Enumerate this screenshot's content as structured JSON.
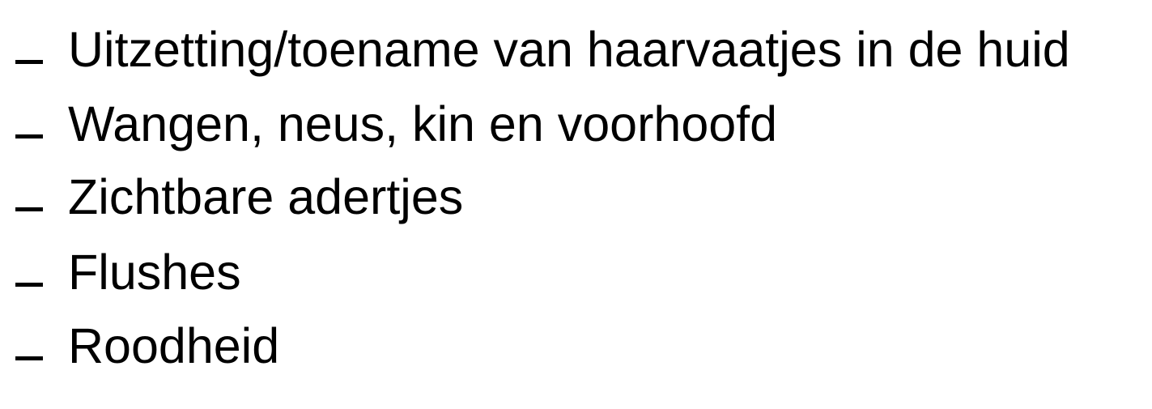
{
  "bullets": [
    {
      "marker": "–",
      "text": "Uitzetting/toename van haarvaatjes in de huid"
    },
    {
      "marker": "–",
      "text": "Wangen, neus, kin en voorhoofd"
    },
    {
      "marker": "–",
      "text": "Zichtbare adertjes"
    },
    {
      "marker": "–",
      "text": "Flushes"
    },
    {
      "marker": "–",
      "text": "Roodheid"
    }
  ]
}
